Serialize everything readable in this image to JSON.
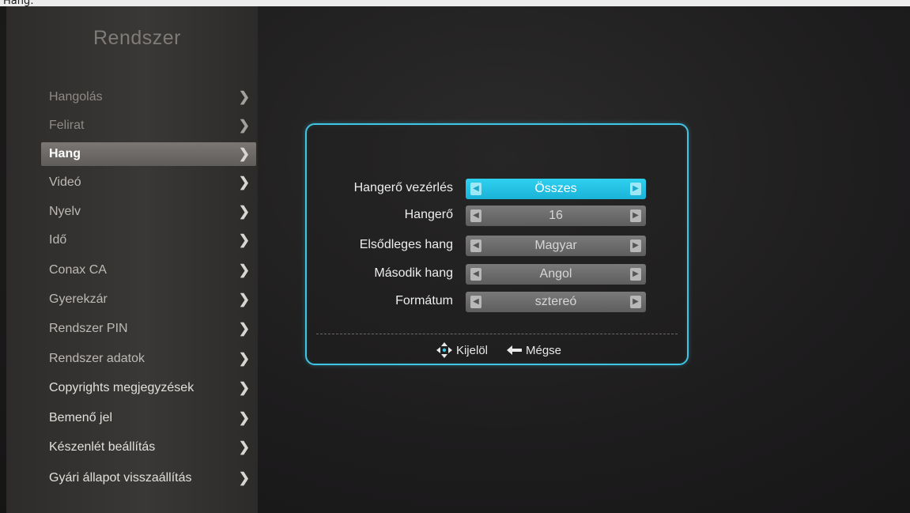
{
  "top_bar": {
    "label": "Hang:"
  },
  "sidebar": {
    "title": "Rendszer",
    "items": [
      {
        "label": "Hangolás",
        "chevron": "❯"
      },
      {
        "label": "Felirat",
        "chevron": "❯"
      },
      {
        "label": "Hang",
        "chevron": "❯",
        "selected": true
      },
      {
        "label": "Videó",
        "chevron": "❯"
      },
      {
        "label": "Nyelv",
        "chevron": "❯"
      },
      {
        "label": "Idő",
        "chevron": "❯"
      },
      {
        "label": "Conax CA",
        "chevron": "❯"
      },
      {
        "label": "Gyerekzár",
        "chevron": "❯"
      },
      {
        "label": "Rendszer PIN",
        "chevron": "❯"
      },
      {
        "label": "Rendszer adatok",
        "chevron": "❯"
      },
      {
        "label": "Copyrights megjegyzések",
        "chevron": "❯"
      },
      {
        "label": "Bemenő jel",
        "chevron": "❯"
      },
      {
        "label": "Készenlét beállítás",
        "chevron": "❯"
      },
      {
        "label": "Gyári állapot visszaállítás",
        "chevron": "❯"
      }
    ]
  },
  "dialog": {
    "rows": [
      {
        "label": "Hangerő vezérlés",
        "value": "Összes",
        "active": true
      },
      {
        "label": "Hangerő",
        "value": "16"
      },
      {
        "label": "Elsődleges hang",
        "value": "Magyar"
      },
      {
        "label": "Második hang",
        "value": "Angol"
      },
      {
        "label": "Formátum",
        "value": "sztereó"
      }
    ],
    "footer": {
      "select_label": "Kijelöl",
      "cancel_label": "Mégse"
    }
  },
  "colors": {
    "accent": "#3fc6e4",
    "active_value_bg": "#1ab3d8",
    "selected_menu_bg": "#6b6865"
  },
  "icons": {
    "select": "dpad-arrows-icon",
    "cancel": "back-arrow-icon",
    "value_left": "triangle-left-icon",
    "value_right": "triangle-right-icon"
  }
}
